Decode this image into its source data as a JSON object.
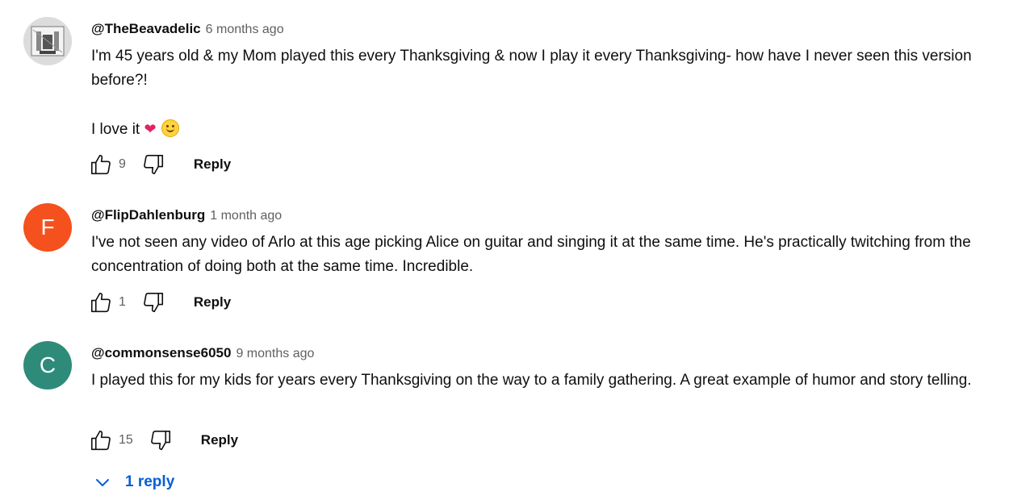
{
  "comments": [
    {
      "author": "@TheBeavadelic",
      "time": "6 months ago",
      "avatar_letter": "",
      "avatar_color": "#e8e8e8",
      "body_lines": [
        "I'm 45 years old & my Mom played this every Thanksgiving & now I play it every Thanksgiving- how have I never seen this version before?!",
        "I love it"
      ],
      "likes": "9",
      "reply_label": "Reply"
    },
    {
      "author": "@FlipDahlenburg",
      "time": "1 month ago",
      "avatar_letter": "F",
      "avatar_color": "#f4511e",
      "body_lines": [
        "I've not seen any video of Arlo at this age picking Alice on guitar and singing it at the same time.  He's practically twitching from the concentration of doing both at the same time.  Incredible."
      ],
      "likes": "1",
      "reply_label": "Reply"
    },
    {
      "author": "@commonsense6050",
      "time": "9 months ago",
      "avatar_letter": "C",
      "avatar_color": "#2e8b7a",
      "body_lines": [
        "I played this for my kids for years every Thanksgiving on the way to a family gathering. A great example of humor and story telling."
      ],
      "likes": "15",
      "reply_label": "Reply",
      "replies_toggle": "1 reply"
    }
  ],
  "icons": {
    "like": "thumbs-up-icon",
    "dislike": "thumbs-down-icon",
    "expand": "chevron-down-icon",
    "heart": "heart-emoji",
    "smile": "smiling-face-emoji"
  },
  "colors": {
    "link_blue": "#065fd4",
    "meta_gray": "#606060"
  }
}
